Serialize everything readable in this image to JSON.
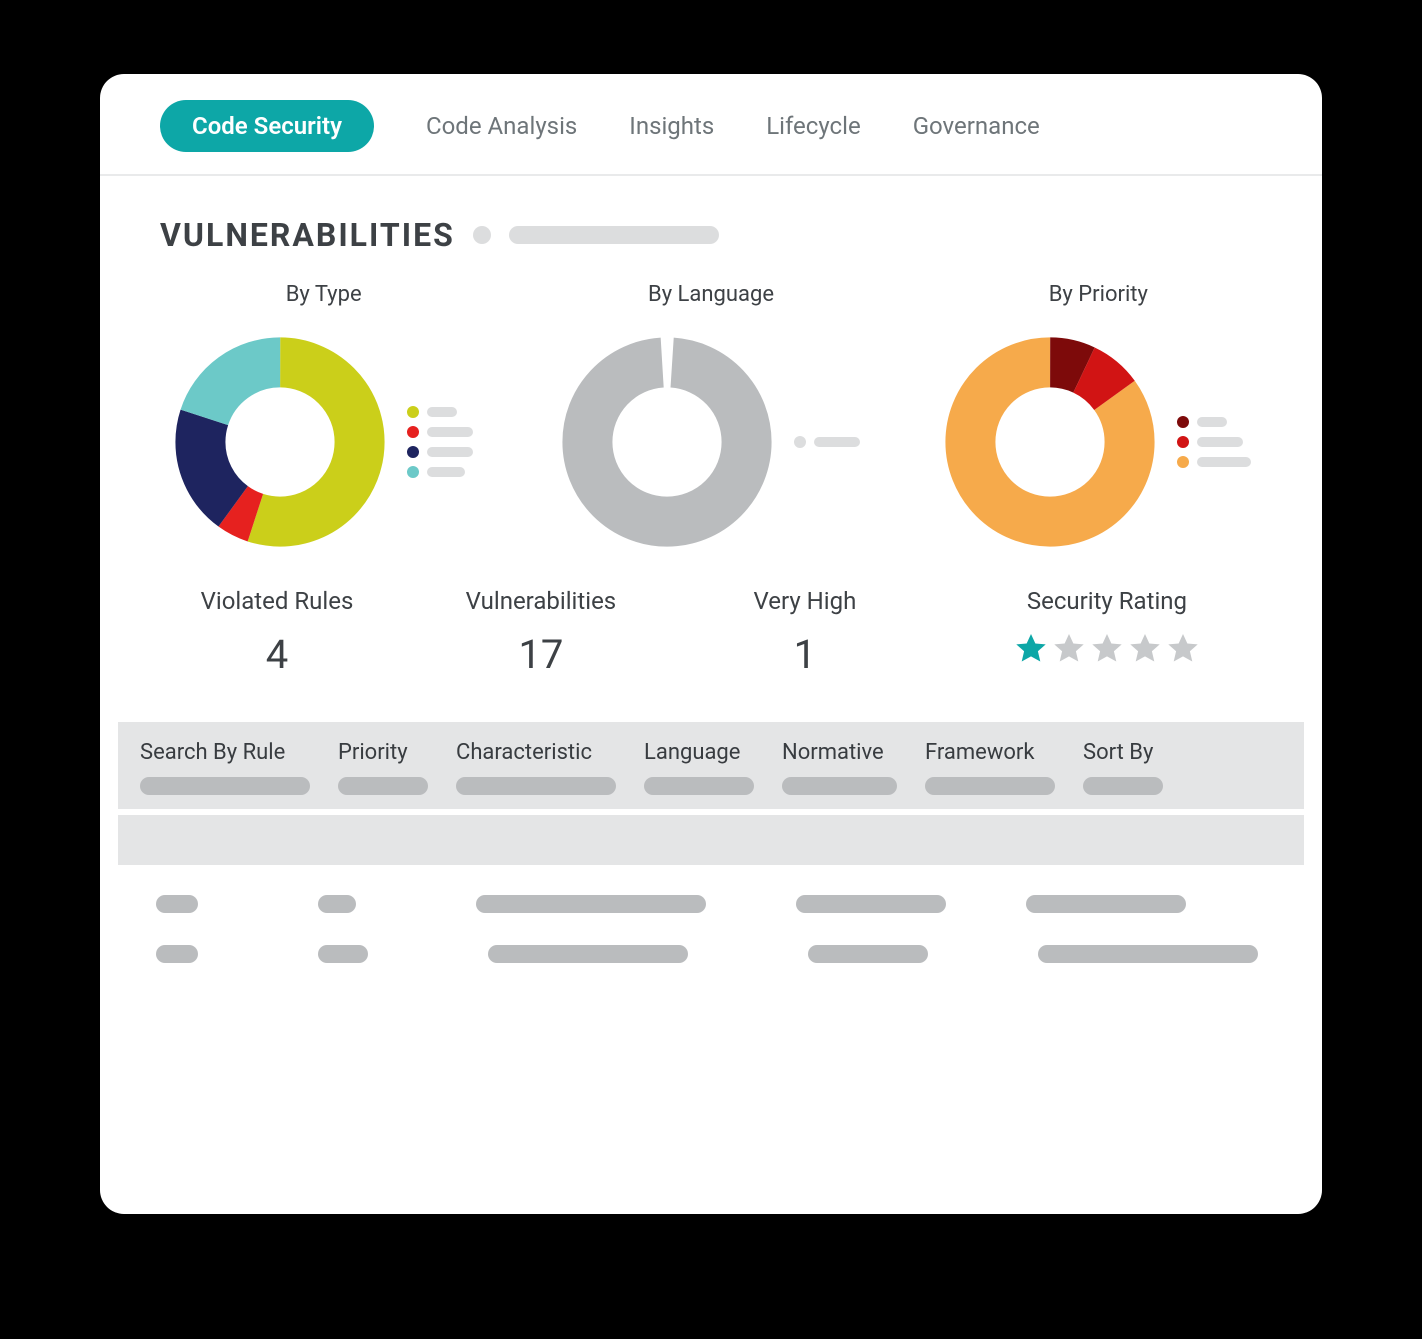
{
  "tabs": [
    "Code Security",
    "Code Analysis",
    "Insights",
    "Lifecycle",
    "Governance"
  ],
  "activeTab": 0,
  "section": {
    "title": "VULNERABILITIES"
  },
  "donuts": {
    "byType": {
      "title": "By Type"
    },
    "byLanguage": {
      "title": "By Language"
    },
    "byPriority": {
      "title": "By Priority"
    }
  },
  "stats": {
    "violatedRules": {
      "label": "Violated Rules",
      "value": "4"
    },
    "vulnerabilities": {
      "label": "Vulnerabilities",
      "value": "17"
    },
    "veryHigh": {
      "label": "Very High",
      "value": "1"
    },
    "securityRating": {
      "label": "Security Rating",
      "stars": 1,
      "maxStars": 5
    }
  },
  "filters": [
    "Search By Rule",
    "Priority",
    "Characteristic",
    "Language",
    "Normative",
    "Framework",
    "Sort By"
  ],
  "chart_data": [
    {
      "type": "pie",
      "title": "By Type",
      "series": [
        {
          "name": "type-a",
          "value": 55,
          "color": "#cbcf1a"
        },
        {
          "name": "type-b",
          "value": 5,
          "color": "#e6211f"
        },
        {
          "name": "type-c",
          "value": 20,
          "color": "#1E245F"
        },
        {
          "name": "type-d",
          "value": 20,
          "color": "#6cc9c8"
        }
      ]
    },
    {
      "type": "pie",
      "title": "By Language",
      "series": [
        {
          "name": "lang-a",
          "value": 100,
          "color": "#babcbe"
        }
      ]
    },
    {
      "type": "pie",
      "title": "By Priority",
      "series": [
        {
          "name": "priority-low",
          "value": 85,
          "color": "#f6aa4b"
        },
        {
          "name": "priority-high",
          "value": 7,
          "color": "#7d0a0a"
        },
        {
          "name": "priority-medium",
          "value": 8,
          "color": "#d11414"
        }
      ]
    }
  ]
}
